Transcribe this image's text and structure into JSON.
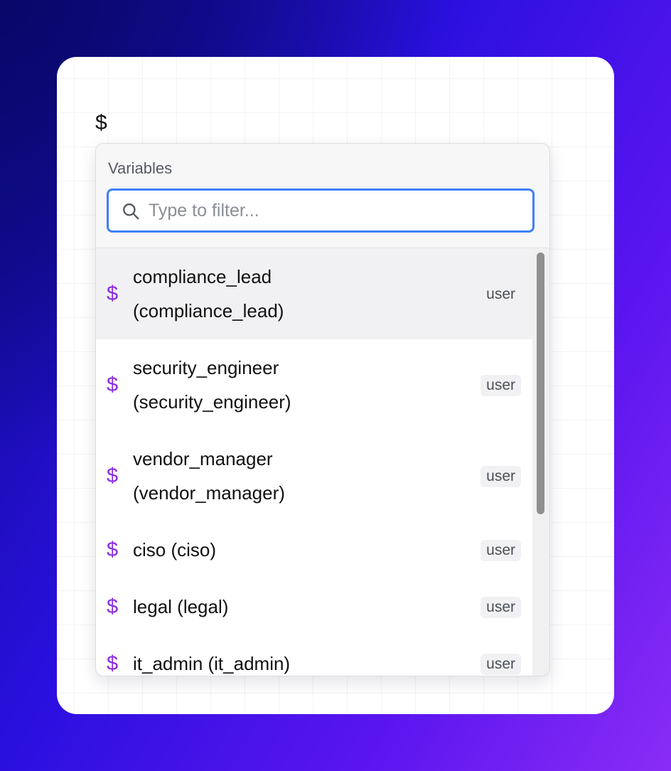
{
  "trigger_symbol": "$",
  "popover": {
    "section_title": "Variables",
    "search": {
      "placeholder": "Type to filter...",
      "value": ""
    },
    "items": [
      {
        "icon": "dollar-icon",
        "symbol": "$",
        "line1": "compliance_lead",
        "line2": "(compliance_lead)",
        "badge": "user",
        "highlighted": true
      },
      {
        "icon": "dollar-icon",
        "symbol": "$",
        "line1": "security_engineer",
        "line2": "(security_engineer)",
        "badge": "user",
        "highlighted": false
      },
      {
        "icon": "dollar-icon",
        "symbol": "$",
        "line1": "vendor_manager",
        "line2": "(vendor_manager)",
        "badge": "user",
        "highlighted": false
      },
      {
        "icon": "dollar-icon",
        "symbol": "$",
        "line1": "ciso (ciso)",
        "badge": "user",
        "highlighted": false
      },
      {
        "icon": "dollar-icon",
        "symbol": "$",
        "line1": "legal (legal)",
        "badge": "user",
        "highlighted": false
      },
      {
        "icon": "dollar-icon",
        "symbol": "$",
        "line1": "it_admin (it_admin)",
        "badge": "user",
        "highlighted": false
      }
    ]
  },
  "colors": {
    "accent_focus": "#3b82f6",
    "variable_icon": "#8b2be2",
    "highlight_row": "#f1f1f3"
  }
}
